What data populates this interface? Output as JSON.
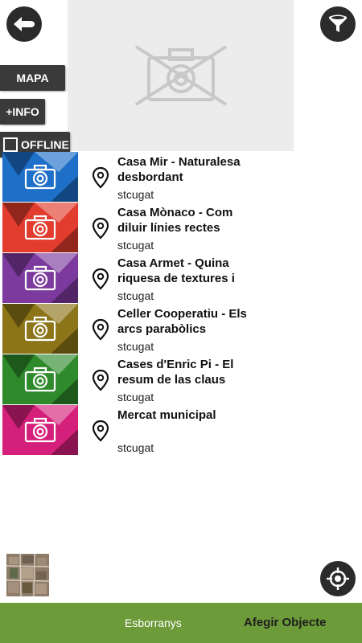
{
  "toolbar": {
    "back_icon": "back-arrow-icon",
    "filter_icon": "filter-funnel-icon"
  },
  "side_buttons": {
    "map_label": "MAPA",
    "info_label": "+INFO",
    "offline_label": "OFFLINE",
    "offline_checked": false
  },
  "items": [
    {
      "title": "Casa Mir - Naturalesa desbordant",
      "subtitle": "stcugat",
      "color": "#1e6fc8"
    },
    {
      "title": "Casa Mònaco - Com diluir línies rectes",
      "subtitle": "stcugat",
      "color": "#e23c2e"
    },
    {
      "title": "Casa Armet - Quina riquesa de textures i",
      "subtitle": "stcugat",
      "color": "#7d3a9e"
    },
    {
      "title": "Celler Cooperatiu - Els arcs parabòlics",
      "subtitle": "stcugat",
      "color": "#8c7418"
    },
    {
      "title": "Cases d'Enric Pi - El resum de las claus",
      "subtitle": "stcugat",
      "color": "#2f8a2c"
    },
    {
      "title": "Mercat municipal",
      "subtitle": "stcugat",
      "color": "#d4207a"
    }
  ],
  "bottom_bar": {
    "drafts_label": "Esborranys",
    "add_label": "Afegir Objecte",
    "color": "#6d9b3a"
  }
}
